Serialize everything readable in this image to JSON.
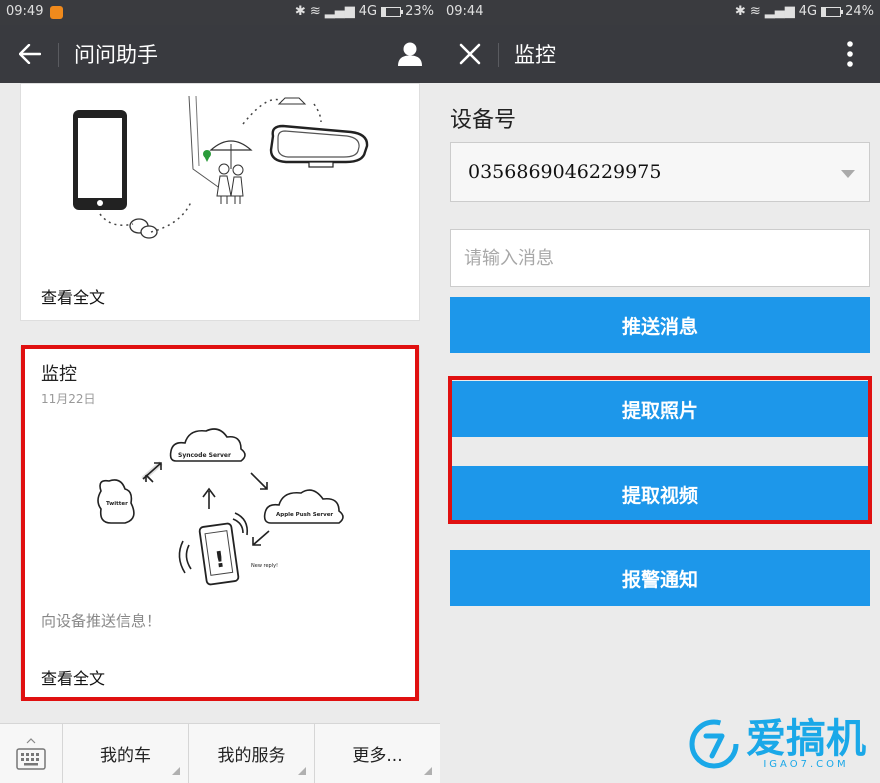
{
  "left": {
    "status": {
      "time": "09:49",
      "network": "4G",
      "battery": "23%",
      "battery_level": 0.23
    },
    "titlebar": {
      "back_icon": "arrow-left-icon",
      "title": "问问助手",
      "profile_icon": "person-icon"
    },
    "card1": {
      "readmore": "查看全文"
    },
    "card2": {
      "title": "监控",
      "date": "11月22日",
      "description": "向设备推送信息！",
      "readmore": "查看全文",
      "illustration": {
        "sync_server": "Syncode Server",
        "twitter": "Twitter",
        "apple": "Apple Push Server",
        "reply": "New reply!"
      }
    },
    "bottom_menu": {
      "keyboard_icon": "keyboard-icon",
      "items": [
        {
          "label": "我的车"
        },
        {
          "label": "我的服务"
        },
        {
          "label": "更多..."
        }
      ]
    },
    "highlight_color": "#e01010"
  },
  "right": {
    "status": {
      "time": "09:44",
      "network": "4G",
      "battery": "24%",
      "battery_level": 0.24
    },
    "titlebar": {
      "close_icon": "close-icon",
      "title": "监控",
      "more_icon": "more-vertical-icon"
    },
    "form": {
      "device_label": "设备号",
      "device_value": "0356869046229975",
      "message_placeholder": "请输入消息",
      "push_button": "推送消息",
      "photo_button": "提取照片",
      "video_button": "提取视频",
      "alarm_button": "报警通知"
    },
    "watermark": {
      "text": "爱搞机",
      "sub": "IGAO7.COM"
    },
    "accent": "#1d97ea"
  }
}
